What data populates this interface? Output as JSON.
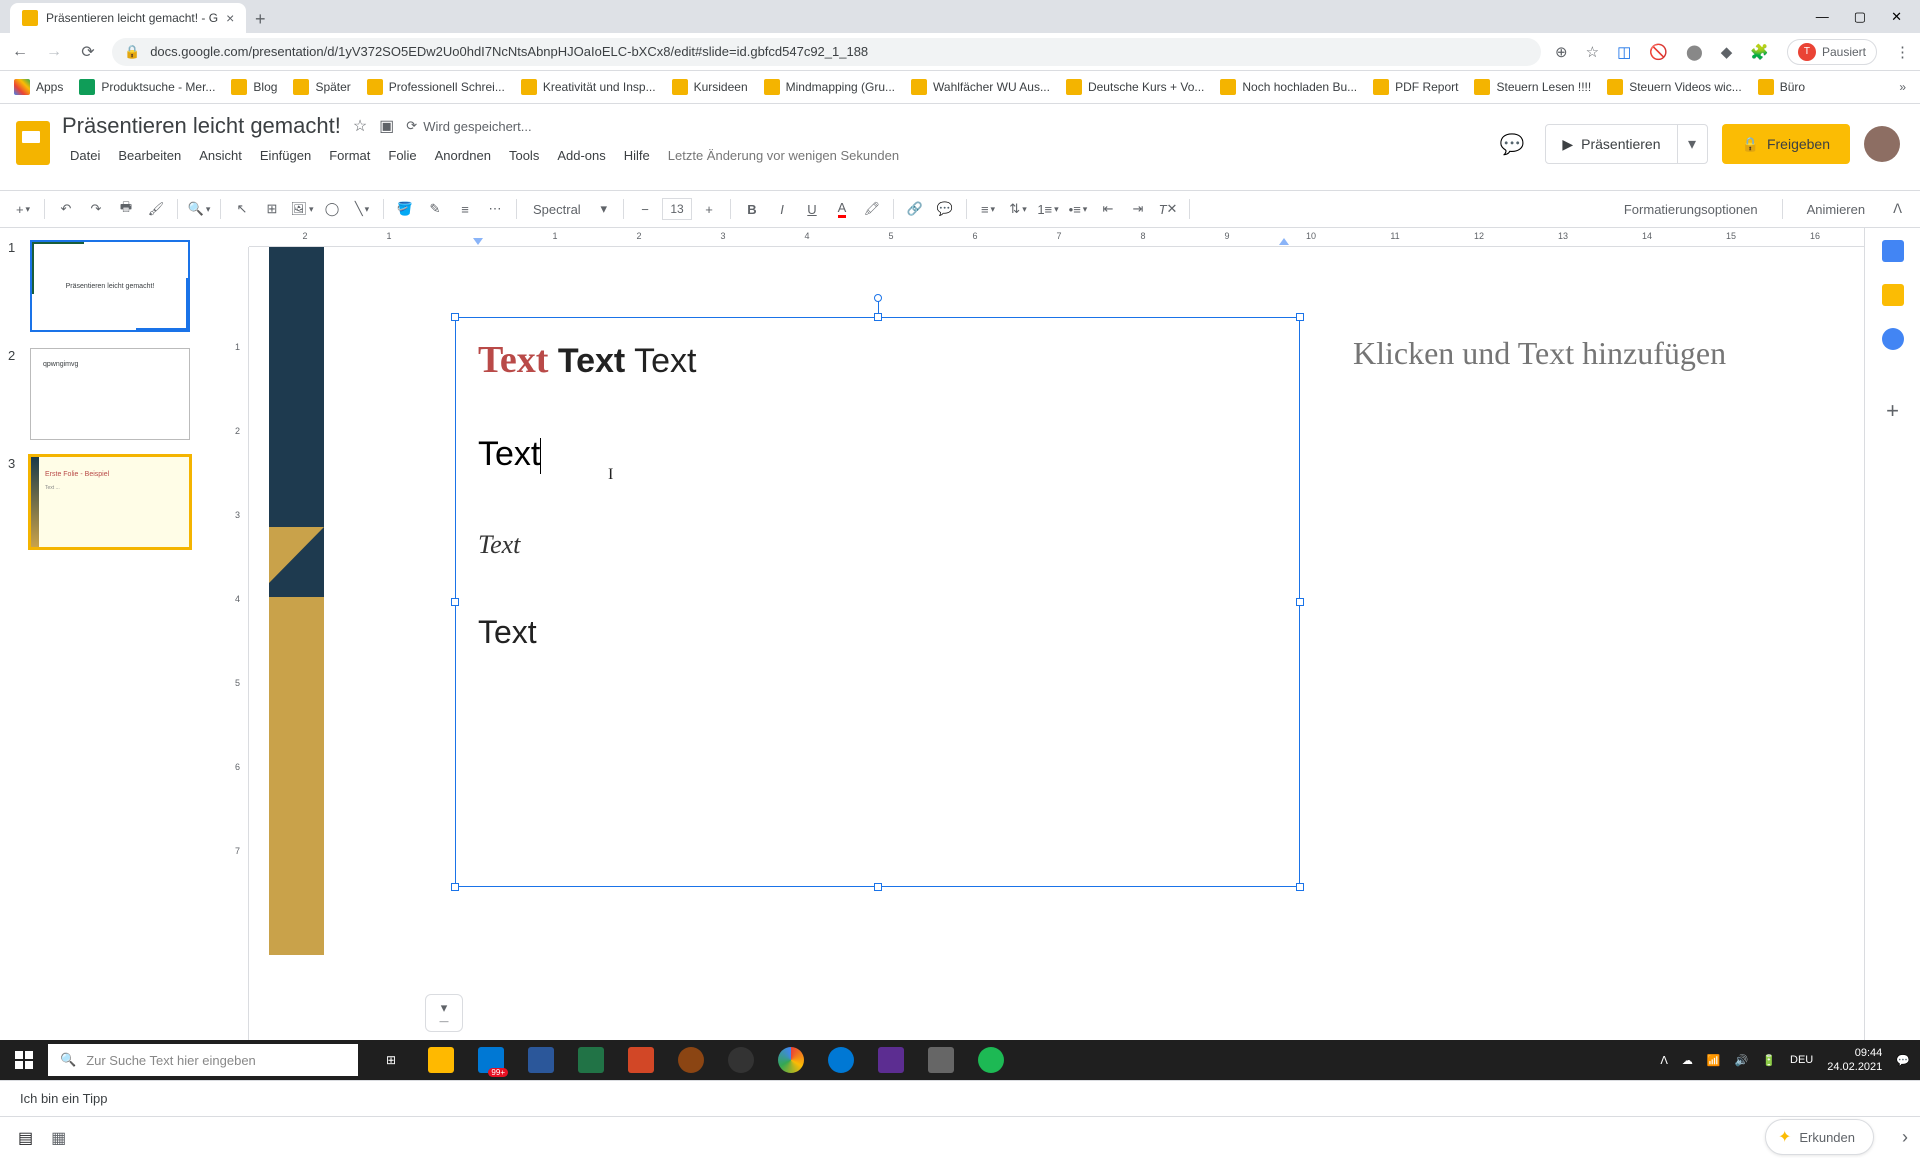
{
  "browser": {
    "tab_title": "Präsentieren leicht gemacht! - G",
    "url": "docs.google.com/presentation/d/1yV372SO5EDw2Uo0hdI7NcNtsAbnpHJOaIoELC-bXCx8/edit#slide=id.gbfcd547c92_1_188",
    "pausiert": "Pausiert"
  },
  "bookmarks": {
    "apps": "Apps",
    "items": [
      "Produktsuche - Mer...",
      "Blog",
      "Später",
      "Professionell Schrei...",
      "Kreativität und Insp...",
      "Kursideen",
      "Mindmapping (Gru...",
      "Wahlfächer WU Aus...",
      "Deutsche Kurs + Vo...",
      "Noch hochladen Bu...",
      "PDF Report",
      "Steuern Lesen !!!!",
      "Steuern Videos wic...",
      "Büro"
    ]
  },
  "doc": {
    "title": "Präsentieren leicht gemacht!",
    "saving": "Wird gespeichert...",
    "last_edit": "Letzte Änderung vor wenigen Sekunden"
  },
  "menus": [
    "Datei",
    "Bearbeiten",
    "Ansicht",
    "Einfügen",
    "Format",
    "Folie",
    "Anordnen",
    "Tools",
    "Add-ons",
    "Hilfe"
  ],
  "header_buttons": {
    "present": "Präsentieren",
    "share": "Freigeben"
  },
  "toolbar": {
    "font": "Spectral",
    "font_size": "13",
    "format_options": "Formatierungsoptionen",
    "animate": "Animieren"
  },
  "ruler_h": [
    "2",
    "1",
    "",
    "1",
    "2",
    "3",
    "4",
    "5",
    "6",
    "7",
    "8",
    "9",
    "10",
    "11",
    "12",
    "13",
    "14",
    "15",
    "16"
  ],
  "ruler_v": [
    "",
    "1",
    "2",
    "3",
    "4",
    "5",
    "6",
    "7"
  ],
  "thumbs": {
    "t1_title": "Präsentieren leicht gemacht!",
    "t2_title": "qpwngimvg",
    "t3_title": "Erste Folie - Beispiel",
    "t3_body": "Text ..."
  },
  "slide": {
    "line1_w1": "Text",
    "line1_w2": "Text",
    "line1_w3": "Text",
    "line2": "Text",
    "line3": "Text",
    "line4": "Text",
    "cursor_mark": "I"
  },
  "speaker_notes_placeholder": "Klicken und Text hinzufügen",
  "speaker_notes_text": "Ich bin ein Tipp",
  "erkunden": "Erkunden",
  "taskbar": {
    "search_placeholder": "Zur Suche Text hier eingeben",
    "lang": "DEU",
    "time": "09:44",
    "date": "24.02.2021",
    "badge": "99+"
  }
}
